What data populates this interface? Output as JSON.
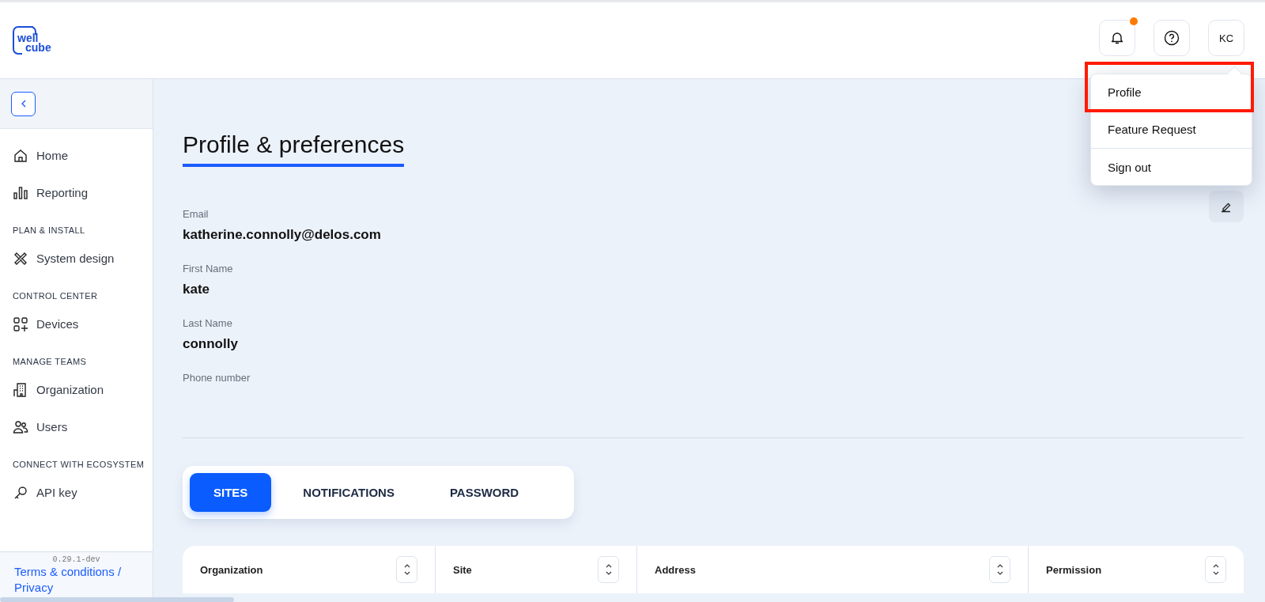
{
  "header": {
    "logo": {
      "line_1": "well",
      "line_2": "cube"
    },
    "notifications_unread": true,
    "avatar_initials": "KC"
  },
  "user_menu": {
    "items": [
      {
        "label": "Profile",
        "highlighted": true
      },
      {
        "label": "Feature Request",
        "highlighted": false
      },
      {
        "label": "Sign out",
        "highlighted": false
      }
    ]
  },
  "sidebar": {
    "sections": [
      {
        "items": [
          {
            "label": "Home"
          },
          {
            "label": "Reporting"
          }
        ]
      },
      {
        "heading": "PLAN & INSTALL",
        "items": [
          {
            "label": "System design"
          }
        ]
      },
      {
        "heading": "CONTROL CENTER",
        "items": [
          {
            "label": "Devices"
          }
        ]
      },
      {
        "heading": "MANAGE TEAMS",
        "items": [
          {
            "label": "Organization"
          },
          {
            "label": "Users"
          }
        ]
      },
      {
        "heading": "CONNECT WITH ECOSYSTEM",
        "items": [
          {
            "label": "API key"
          }
        ]
      }
    ],
    "version": "0.29.1-dev",
    "footer_link": "Terms & conditions / Privacy"
  },
  "page": {
    "title": "Profile & preferences",
    "fields": [
      {
        "label": "Email",
        "value": "katherine.connolly@delos.com"
      },
      {
        "label": "First Name",
        "value": "kate"
      },
      {
        "label": "Last Name",
        "value": "connolly"
      },
      {
        "label": "Phone number"
      }
    ],
    "tabs": [
      {
        "label": "SITES",
        "selected": true
      },
      {
        "label": "NOTIFICATIONS",
        "selected": false
      },
      {
        "label": "PASSWORD",
        "selected": false
      }
    ],
    "table": {
      "columns": [
        "Organization",
        "Site",
        "Address",
        "Permission"
      ]
    }
  }
}
